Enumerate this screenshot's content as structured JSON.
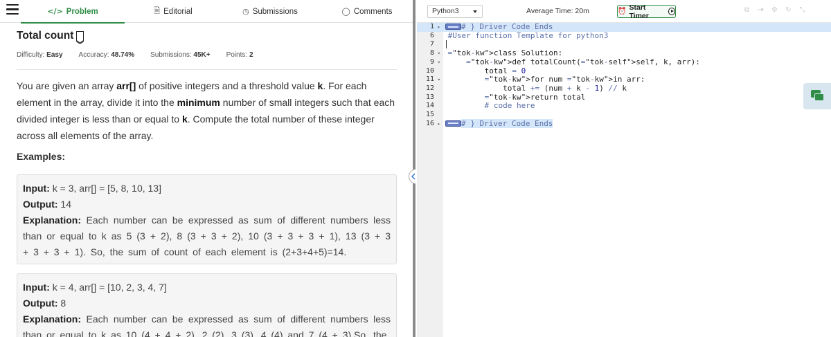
{
  "tabs": [
    {
      "label": "Problem",
      "icon": "code-icon",
      "glyph": "</>"
    },
    {
      "label": "Editorial",
      "icon": "document-icon",
      "glyph": "🗎"
    },
    {
      "label": "Submissions",
      "icon": "clock-icon",
      "glyph": "◷"
    },
    {
      "label": "Comments",
      "icon": "comment-icon",
      "glyph": "◯"
    }
  ],
  "problem": {
    "title": "Total count",
    "meta": {
      "difficulty_label": "Difficulty:",
      "difficulty": "Easy",
      "accuracy_label": "Accuracy:",
      "accuracy": "48.74%",
      "submissions_label": "Submissions:",
      "submissions": "45K+",
      "points_label": "Points:",
      "points": "2"
    },
    "description": {
      "p1": "You are given an array ",
      "arr": "arr[]",
      "p2": " of positive integers and a threshold value ",
      "k1": "k",
      "p3": ". For each element in the array, divide it into the ",
      "minimum": "minimum",
      "p4": " number of small integers such that each divided integer is less than or equal to ",
      "k2": "k",
      "p5": ". Compute the total number of these integer across all elements of the array."
    },
    "examples_heading": "Examples:",
    "examples": [
      {
        "input_label": "Input:",
        "input": "k = 3, arr[] = [5, 8, 10, 13]",
        "output_label": "Output:",
        "output": "14",
        "explanation_label": "Explanation:",
        "explanation": "Each number can be expressed as sum of different numbers less than or equal to k as 5 (3 + 2), 8 (3 + 3 + 2), 10 (3 + 3 + 3 + 1), 13 (3 + 3 + 3 + 3 + 1). So, the sum of count of each element is (2+3+4+5)=14."
      },
      {
        "input_label": "Input:",
        "input": "k = 4, arr[] = [10, 2, 3, 4, 7]",
        "output_label": "Output:",
        "output": "8",
        "explanation_label": "Explanation:",
        "explanation": "Each number can be expressed as sum of different numbers less than or equal to k as 10 (4 + 4 + 2), 2 (2), 3 (3), 4 (4) and 7 (4 + 3).So, the"
      }
    ]
  },
  "editor_toolbar": {
    "language": "Python3",
    "average_time": "Average Time: 20m",
    "start_timer": "Start Timer",
    "icons": [
      "copy-icon",
      "import-icon",
      "settings-icon",
      "reset-icon",
      "fullscreen-icon"
    ]
  },
  "code": {
    "lines": [
      {
        "num": "1",
        "fold": "▸",
        "text": "# } Driver Code Ends",
        "marker": true,
        "kind": "comment",
        "highlight": true
      },
      {
        "num": "6",
        "fold": "",
        "text": "#User function Template for python3",
        "kind": "comment"
      },
      {
        "num": "7",
        "fold": "",
        "text": "",
        "kind": "plain"
      },
      {
        "num": "8",
        "fold": "▾",
        "text": "class Solution:",
        "kind": "class"
      },
      {
        "num": "9",
        "fold": "▾",
        "text": "    def totalCount(self, k, arr):",
        "kind": "def"
      },
      {
        "num": "10",
        "fold": "",
        "text": "        total = 0",
        "kind": "assign"
      },
      {
        "num": "11",
        "fold": "▾",
        "text": "        for num in arr:",
        "kind": "for"
      },
      {
        "num": "12",
        "fold": "",
        "text": "            total += (num + k - 1) // k",
        "kind": "expr"
      },
      {
        "num": "13",
        "fold": "",
        "text": "        return total",
        "kind": "return"
      },
      {
        "num": "14",
        "fold": "",
        "text": "        # code here",
        "kind": "comment"
      },
      {
        "num": "15",
        "fold": "",
        "text": "",
        "kind": "plain"
      },
      {
        "num": "16",
        "fold": "▸",
        "text": "# } Driver Code Ends",
        "marker": true,
        "kind": "comment",
        "highlight_text": true
      }
    ]
  },
  "colors": {
    "accent": "#2f8d46",
    "highlight": "#d3e6fa",
    "keyword": "#1a3bd1"
  }
}
